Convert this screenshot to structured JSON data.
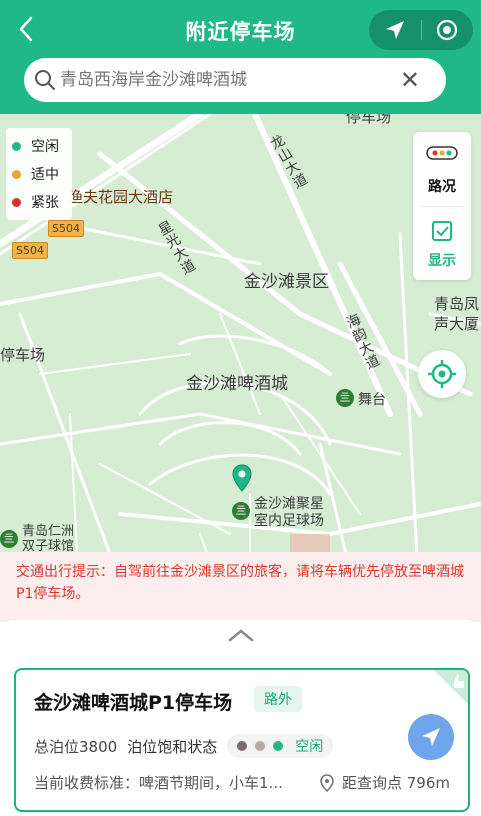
{
  "header": {
    "title": "附近停车场",
    "back_icon": "back-chevron-icon",
    "search_placeholder": "青岛西海岸金沙滩啤酒城"
  },
  "map": {
    "labels": {
      "hotel": "渔夫花园大酒店",
      "road_xingguang": "星光大道",
      "road_longshan": "龙山大道",
      "scenic": "金沙滩景区",
      "road_haiyun": "海韵大道",
      "venue": "金沙滩啤酒城",
      "stage": "舞台",
      "football": "金沙滩聚星\n室内足球场",
      "parking_left": "停车场",
      "parking_top": "停车场",
      "right_label": "青岛凤\n声大厦",
      "bottom_left": "青岛仁洲\n双子球馆"
    },
    "road_badges": [
      "S504",
      "S504"
    ],
    "legend": [
      {
        "label": "空闲",
        "color": "#1fb886"
      },
      {
        "label": "适中",
        "color": "#f0a035"
      },
      {
        "label": "紧张",
        "color": "#d9312b"
      }
    ],
    "side_panel": {
      "traffic_label": "路况",
      "show_label": "显示"
    },
    "accent": "#1fb886"
  },
  "notice": {
    "text": "交通出行提示：自驾前往金沙滩景区的旅客，请将车辆优先停放至啤酒城P1停车场。"
  },
  "card": {
    "name": "金沙滩啤酒城P1停车场",
    "tag": "路外",
    "total_spaces": "总泊位3800",
    "saturation_label": "泊位饱和状态",
    "status": "空闲",
    "fee": "当前收费标准：啤酒节期间，小车1...",
    "distance": "距查询点 796m"
  }
}
